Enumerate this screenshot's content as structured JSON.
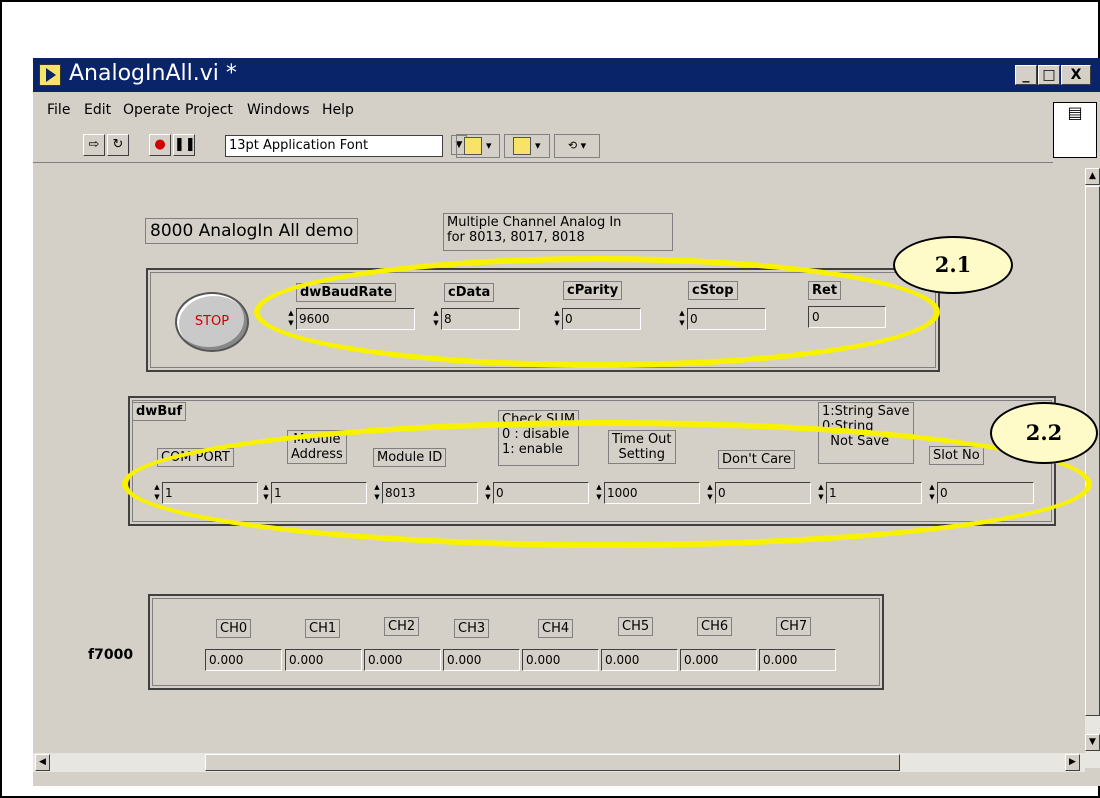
{
  "window": {
    "title": "AnalogInAll.vi *",
    "min": "_",
    "max": "□",
    "close": "X"
  },
  "menu": [
    "File",
    "Edit",
    "Operate",
    "Project",
    "Windows",
    "Help"
  ],
  "toolbar": {
    "font": "13pt Application Font"
  },
  "panel": {
    "title_label": "8000 AnalogIn All demo",
    "desc_label": "Multiple Channel Analog In\nfor 8013, 8017, 8018",
    "stop_label": "STOP",
    "params": [
      {
        "label": "dwBaudRate",
        "value": "9600"
      },
      {
        "label": "cData",
        "value": "8"
      },
      {
        "label": "cParity",
        "value": "0"
      },
      {
        "label": "cStop",
        "value": "0"
      }
    ],
    "ret": {
      "label": "Ret",
      "value": "0"
    },
    "dwbuf": {
      "label": "dwBuf",
      "headers": [
        "COM PORT",
        "Module\nAddress",
        "Module ID",
        "Check SUM\n0 : disable\n1: enable",
        "Time Out\nSetting",
        "Don't Care",
        "1:String Save\n0:String\n  Not Save",
        "Slot No"
      ],
      "values": [
        "1",
        "1",
        "8013",
        "0",
        "1000",
        "0",
        "1",
        "0"
      ]
    },
    "f7000": {
      "label": "f7000",
      "channels": [
        "CH0",
        "CH1",
        "CH2",
        "CH3",
        "CH4",
        "CH5",
        "CH6",
        "CH7"
      ],
      "values": [
        "0.000",
        "0.000",
        "0.000",
        "0.000",
        "0.000",
        "0.000",
        "0.000",
        "0.000"
      ]
    }
  },
  "callouts": [
    "2.1",
    "2.2"
  ],
  "colors": {
    "titlebar": "#0a246a",
    "panel": "#d4d0c8",
    "highlight": "#f8f200",
    "stop_text": "#d00000"
  }
}
